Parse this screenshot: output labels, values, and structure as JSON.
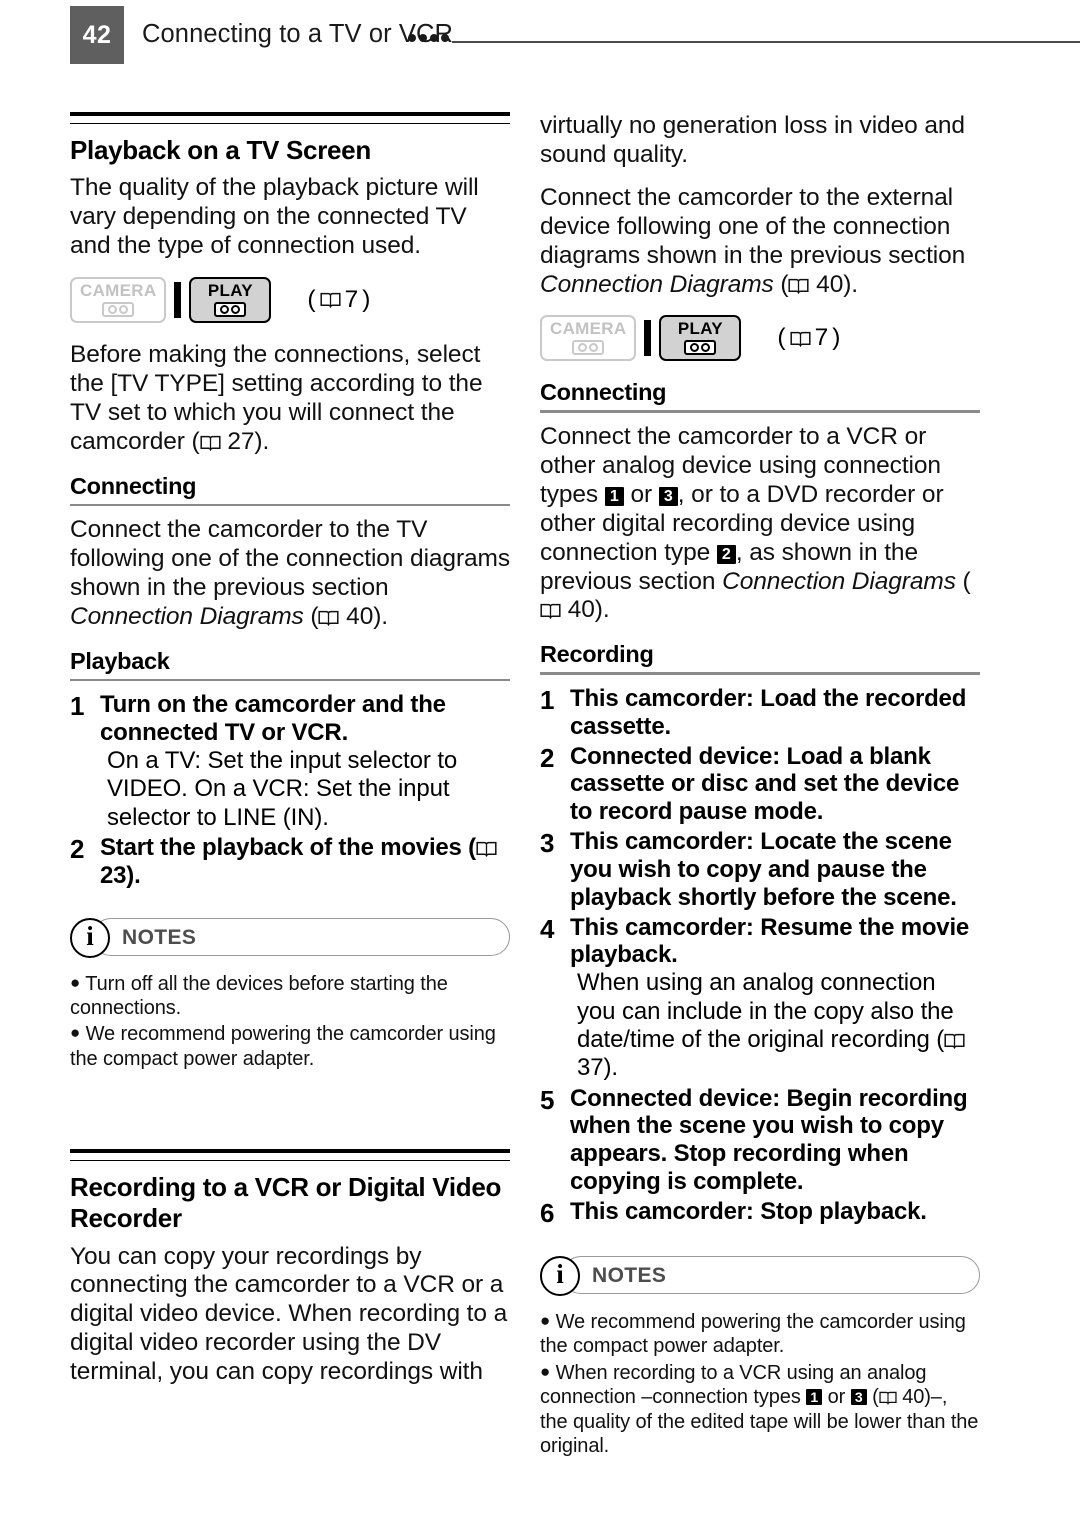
{
  "header": {
    "page_number": "42",
    "title": "Connecting to a TV or VCR",
    "dot_count": 4
  },
  "icons": {
    "book": "book-icon",
    "info": "i",
    "bullet": "●"
  },
  "mode_badges": {
    "camera_label": "CAMERA",
    "play_label": "PLAY",
    "reference": "7"
  },
  "left_column": {
    "section_title": "Playback on a TV Screen",
    "intro": "The quality of the playback picture will vary depending on the connected TV and the type of connection used.",
    "mode_ref_open": "(",
    "mode_ref_page": "7",
    "mode_ref_close": ")",
    "tv_type_text_a": "Before making the connections, select the [TV TYPE] setting according to the TV set to which you will connect the camcorder (",
    "tv_type_page": "27",
    "tv_type_text_b": ").",
    "connecting_heading": "Connecting",
    "connecting_text_a": "Connect the camcorder to the TV following one of the connection diagrams shown in the previous section ",
    "connecting_italic": "Connection Diagrams",
    "connecting_text_b": " (",
    "connecting_page": "40",
    "connecting_text_c": ").",
    "playback_heading": "Playback",
    "playback_steps": [
      {
        "num": "1",
        "title": "Turn on the camcorder and the connected TV or VCR.",
        "detail": "On a TV: Set the input selector to VIDEO. On a VCR: Set the input selector to LINE (IN)."
      },
      {
        "num": "2",
        "title_a": "Start the playback of the movies (",
        "title_page": "23",
        "title_b": ")."
      }
    ],
    "notes_label": "NOTES",
    "notes": [
      "Turn off all the devices before starting the connections.",
      "We recommend powering the camcorder using the compact power adapter."
    ],
    "section2_title_line1": "Recording to a VCR or Digital Video",
    "section2_title_line2": "Recorder",
    "section2_intro": "You can copy your recordings by connecting the camcorder to a VCR or a digital video device. When recording to a digital video recorder using the DV terminal, you can copy recordings with"
  },
  "right_column": {
    "continuation": "virtually no generation loss in video and sound quality.",
    "connect_text_a": "Connect the camcorder to the external device following one of the connection diagrams shown in the previous section ",
    "connect_italic": "Connection Diagrams",
    "connect_text_b": " (",
    "connect_page": "40",
    "connect_text_c": ").",
    "mode_ref_page": "7",
    "connecting_heading": "Connecting",
    "connecting_p_a": "Connect the camcorder to a VCR or other analog device using connection types ",
    "conn_badge_1": "1",
    "connecting_p_b": " or ",
    "conn_badge_3": "3",
    "connecting_p_c": ", or to a DVD recorder or other digital recording device using connection type ",
    "conn_badge_2": "2",
    "connecting_p_d": ", as shown in the previous section ",
    "connecting_italic": "Connection Diagrams",
    "connecting_p_e": " (",
    "connecting_page": "40",
    "connecting_p_f": ").",
    "recording_heading": "Recording",
    "recording_steps": [
      {
        "num": "1",
        "title": "This camcorder: Load the recorded cassette."
      },
      {
        "num": "2",
        "title": "Connected device: Load a blank cassette or disc and set the device to record pause mode."
      },
      {
        "num": "3",
        "title": "This camcorder: Locate the scene you wish to copy and pause the playback shortly before the scene."
      },
      {
        "num": "4",
        "title": "This camcorder: Resume the movie playback.",
        "detail_a": "When using an analog connection you can include in the copy also the date/time of the original recording (",
        "detail_page": "37",
        "detail_b": ")."
      },
      {
        "num": "5",
        "title": "Connected device: Begin recording when the scene you wish to copy appears. Stop recording when copying is complete."
      },
      {
        "num": "6",
        "title": "This camcorder: Stop playback."
      }
    ],
    "notes_label": "NOTES",
    "note1": "We recommend powering the camcorder using the compact power adapter.",
    "note2_a": "When recording to a VCR using an analog connection –connection types ",
    "note2_badge1": "1",
    "note2_mid": " or ",
    "note2_badge3": "3",
    "note2_b": " (",
    "note2_page": "40",
    "note2_c": ")–, the quality of the edited tape will be lower than the original."
  }
}
